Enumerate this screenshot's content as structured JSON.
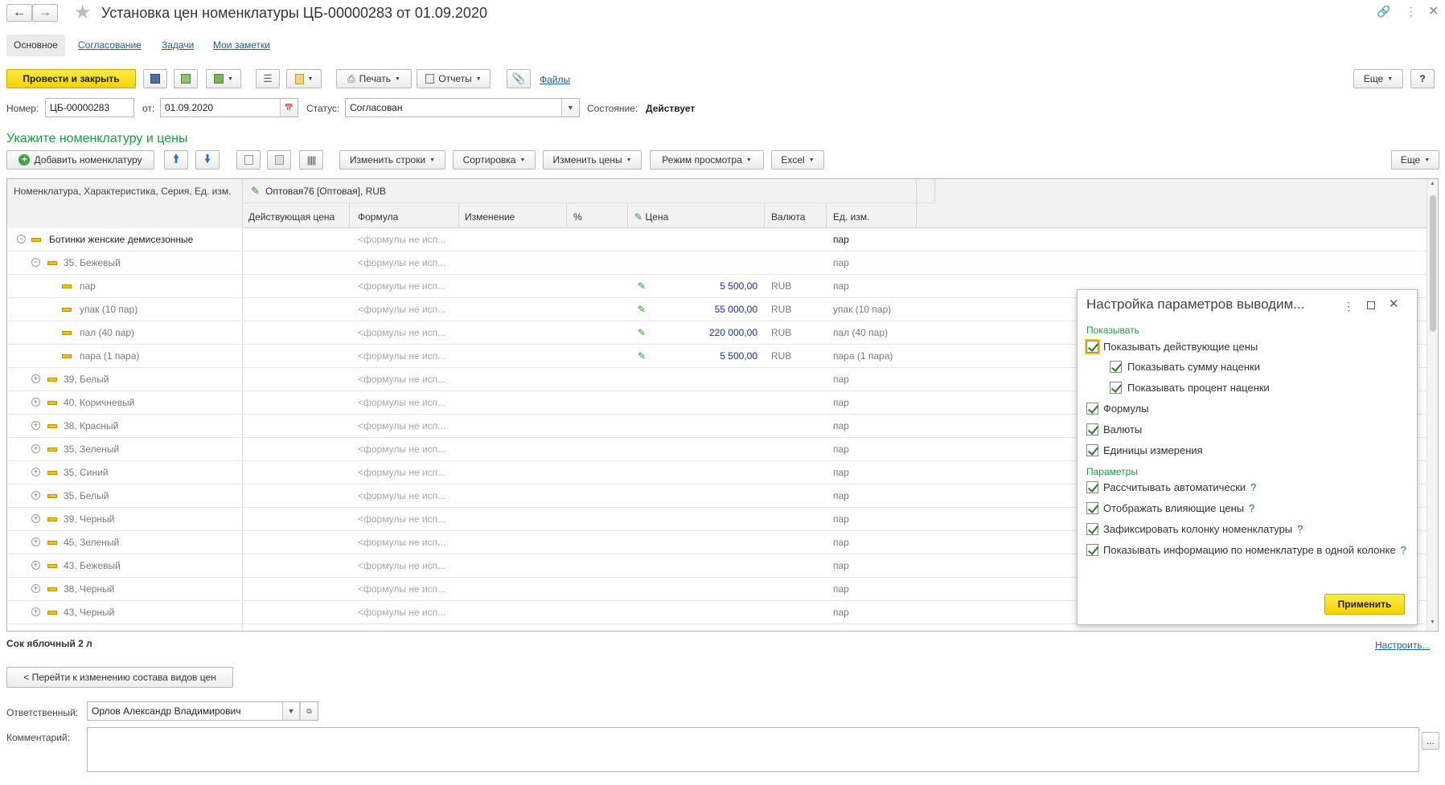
{
  "window": {
    "title": "Установка цен номенклатуры ЦБ-00000283 от 01.09.2020"
  },
  "tabs": [
    "Основное",
    "Согласование",
    "Задачи",
    "Мои заметки"
  ],
  "toolbar": {
    "post_close": "Провести и закрыть",
    "print": "Печать",
    "reports": "Отчеты",
    "files": "Файлы",
    "more": "Еще",
    "help": "?"
  },
  "header": {
    "number_label": "Номер:",
    "number": "ЦБ-00000283",
    "date_label": "от:",
    "date": "01.09.2020",
    "status_label": "Статус:",
    "status": "Согласован",
    "state_label": "Состояние:",
    "state": "Действует"
  },
  "section": {
    "title": "Укажите номенклатуру и цены"
  },
  "table_toolbar": {
    "add": "Добавить номенклатуру",
    "change_rows": "Изменить строки",
    "sort": "Сортировка",
    "change_prices": "Изменить цены",
    "view_mode": "Режим просмотра",
    "excel": "Excel",
    "more": "Еще"
  },
  "table": {
    "col_nomenclature": "Номенклатура, Характеристика, Серия, Ед. изм.",
    "price_type": "Оптовая76 [Оптовая], RUB",
    "columns": [
      "Действующая цена",
      "Формула",
      "Изменение",
      "%",
      "Цена",
      "Валюта",
      "Ед. изм."
    ],
    "rows": [
      {
        "name": "Ботинки женские демисезонные",
        "formula": "<формулы не исп...",
        "price": "",
        "currency": "",
        "unit": "пар"
      },
      {
        "name": "35, Бежевый",
        "formula": "<формулы не исп...",
        "price": "",
        "currency": "",
        "unit": "пар"
      },
      {
        "name": "пар",
        "formula": "<формулы не исп...",
        "price": "5 500,00",
        "currency": "RUB",
        "unit": "пар"
      },
      {
        "name": "упак (10 пар)",
        "formula": "<формулы не исп...",
        "price": "55 000,00",
        "currency": "RUB",
        "unit": "упак (10 пар)"
      },
      {
        "name": "пал (40 пар)",
        "formula": "<формулы не исп...",
        "price": "220 000,00",
        "currency": "RUB",
        "unit": "пал (40 пар)"
      },
      {
        "name": "пара (1 пара)",
        "formula": "<формулы не исп...",
        "price": "5 500,00",
        "currency": "RUB",
        "unit": "пара (1 пара)"
      },
      {
        "name": "39, Белый",
        "formula": "<формулы не исп...",
        "price": "",
        "currency": "",
        "unit": "пар"
      },
      {
        "name": "40, Коричневый",
        "formula": "<формулы не исп...",
        "price": "",
        "currency": "",
        "unit": "пар"
      },
      {
        "name": "38, Красный",
        "formula": "<формулы не исп...",
        "price": "",
        "currency": "",
        "unit": "пар"
      },
      {
        "name": "35, Зеленый",
        "formula": "<формулы не исп...",
        "price": "",
        "currency": "",
        "unit": "пар"
      },
      {
        "name": "35, Синий",
        "formula": "<формулы не исп...",
        "price": "",
        "currency": "",
        "unit": "пар"
      },
      {
        "name": "35, Белый",
        "formula": "<формулы не исп...",
        "price": "",
        "currency": "",
        "unit": "пар"
      },
      {
        "name": "39, Черный",
        "formula": "<формулы не исп...",
        "price": "",
        "currency": "",
        "unit": "пар"
      },
      {
        "name": "45, Зеленый",
        "formula": "<формулы не исп...",
        "price": "",
        "currency": "",
        "unit": "пар"
      },
      {
        "name": "43, Бежевый",
        "formula": "<формулы не исп...",
        "price": "",
        "currency": "",
        "unit": "пар"
      },
      {
        "name": "38, Черный",
        "formula": "<формулы не исп...",
        "price": "",
        "currency": "",
        "unit": "пар"
      },
      {
        "name": "43, Черный",
        "formula": "<формулы не исп...",
        "price": "",
        "currency": "",
        "unit": "пар"
      }
    ]
  },
  "footer": {
    "selected_item": "Сок яблочный 2 л",
    "configure": "Настроить...",
    "goto_price_types": "< Перейти к изменению состава видов цен",
    "responsible_label": "Ответственный:",
    "responsible": "Орлов Александр Владимирович",
    "comment_label": "Комментарий:",
    "comment_btn": "..."
  },
  "popup": {
    "title": "Настройка параметров выводим...",
    "show_group": "Показывать",
    "options": [
      "Показывать действующие цены",
      "Показывать сумму наценки",
      "Показывать процент наценки",
      "Формулы",
      "Валюты",
      "Единицы измерения"
    ],
    "params_group": "Параметры",
    "params": [
      "Рассчитывать автоматически",
      "Отображать влияющие цены",
      "Зафиксировать колонку номенклатуры",
      "Показывать информацию по номенклатуре в одной колонке"
    ],
    "help_mark": "?",
    "apply": "Применить"
  }
}
